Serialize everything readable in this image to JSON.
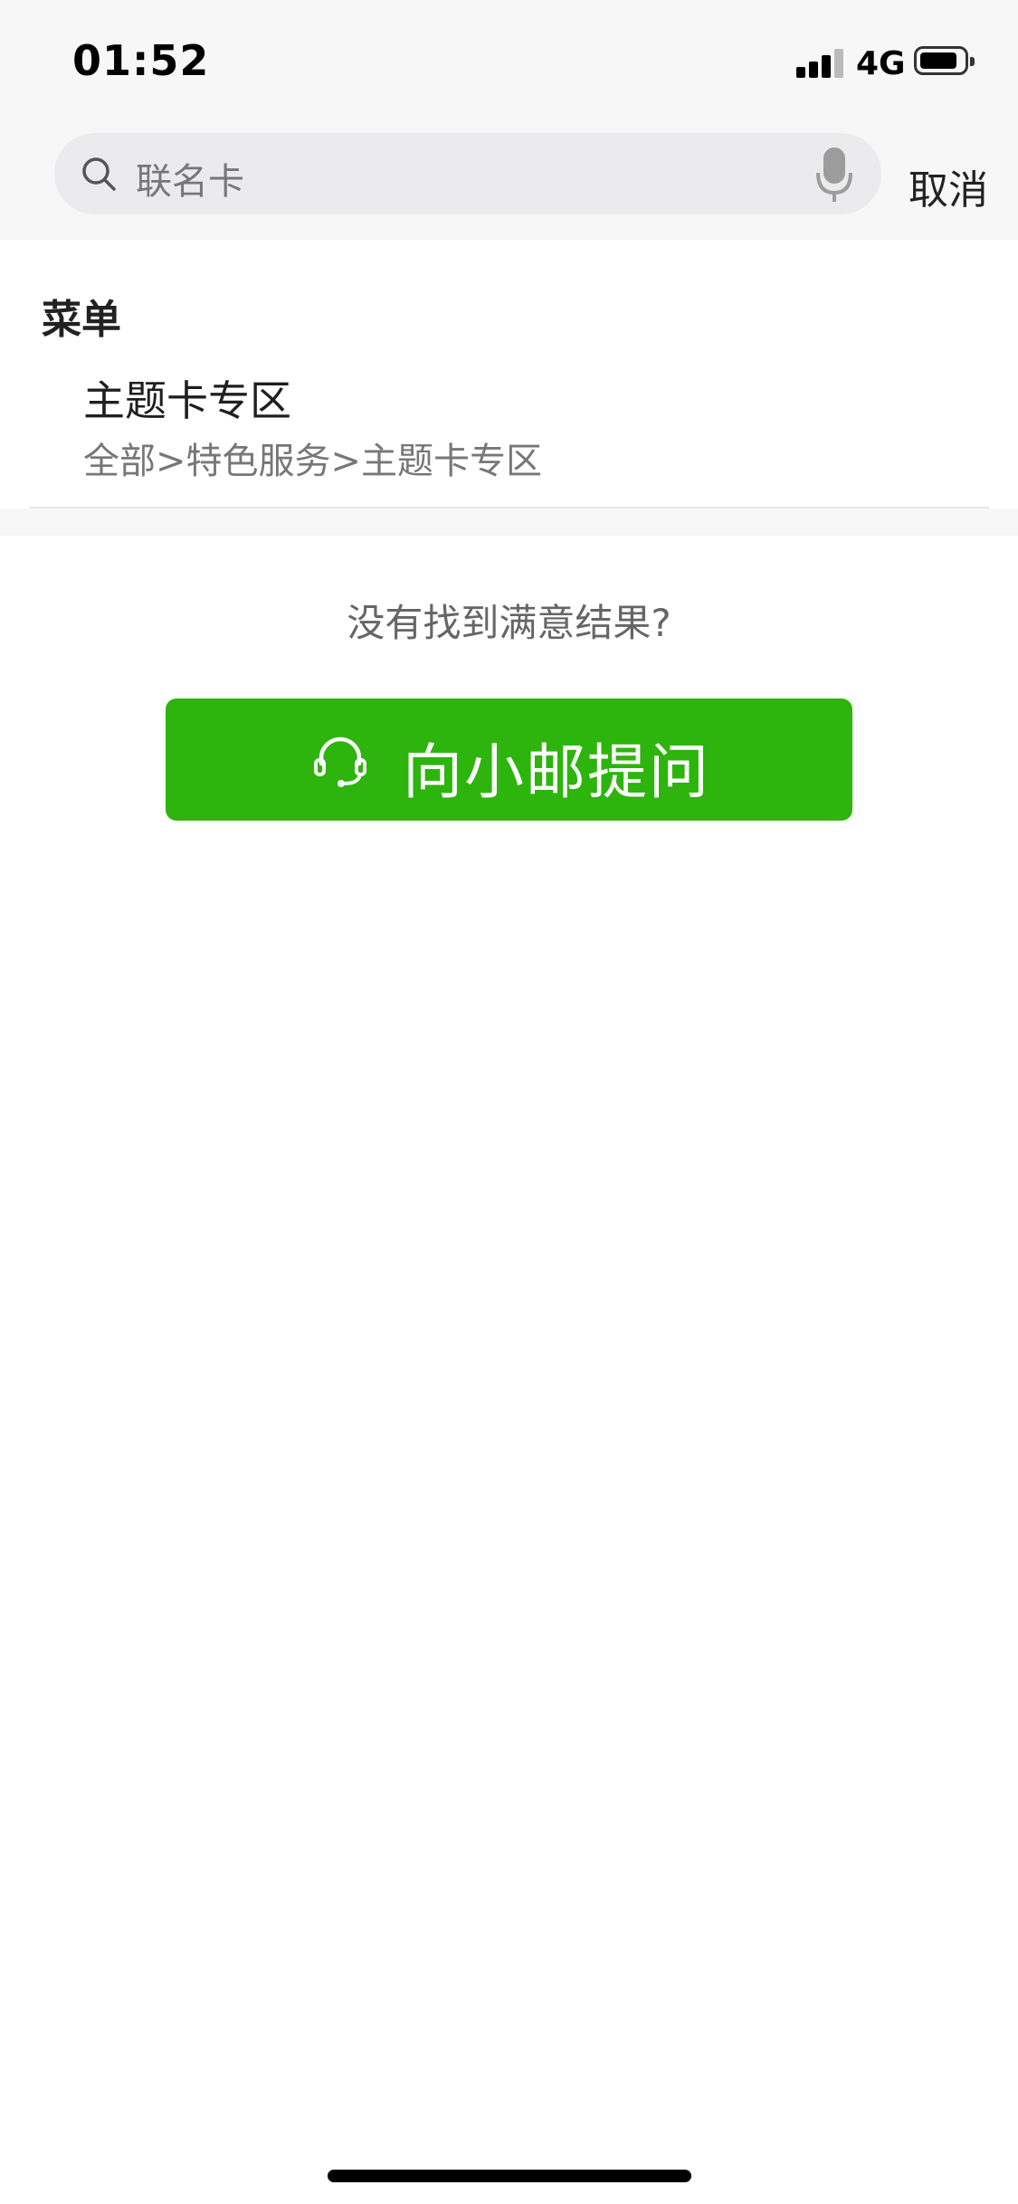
{
  "status_bar": {
    "time": "01:52",
    "network": "4G"
  },
  "search": {
    "query": "联名卡",
    "cancel_label": "取消"
  },
  "results": {
    "section_title": "菜单",
    "items": [
      {
        "title": "主题卡专区",
        "path": "全部>特色服务>主题卡专区"
      }
    ]
  },
  "not_found": {
    "prompt": "没有找到满意结果?",
    "ask_button_label": "向小邮提问"
  },
  "colors": {
    "accent": "#2db40d",
    "background": "#f7f7f7"
  },
  "icons": [
    "search-icon",
    "microphone-icon",
    "headset-icon",
    "signal-icon",
    "battery-icon"
  ]
}
